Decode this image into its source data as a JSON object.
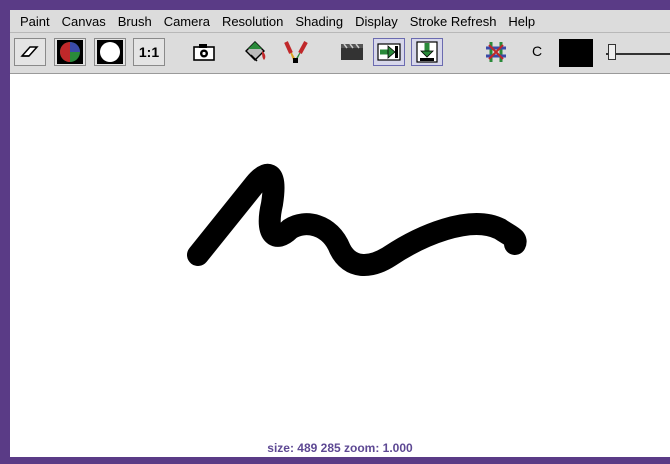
{
  "menu": [
    "Paint",
    "Canvas",
    "Brush",
    "Camera",
    "Resolution",
    "Shading",
    "Display",
    "Stroke Refresh",
    "Help"
  ],
  "toolbar": {
    "one_to_one_label": "1:1",
    "channel_label": "C",
    "color_value": "#000000",
    "icons": [
      "eraser-icon",
      "color-sphere-icon",
      "white-circle-icon",
      "camera-icon",
      "paint-bucket-icon",
      "brush-icon",
      "clapper-icon",
      "arrow-right-icon",
      "arrow-down-icon",
      "wrap-icon"
    ]
  },
  "canvas": {
    "background": "#ffffff",
    "stroke_color": "#000000"
  },
  "status": {
    "text": "size:  489  285 zoom: 1.000"
  }
}
